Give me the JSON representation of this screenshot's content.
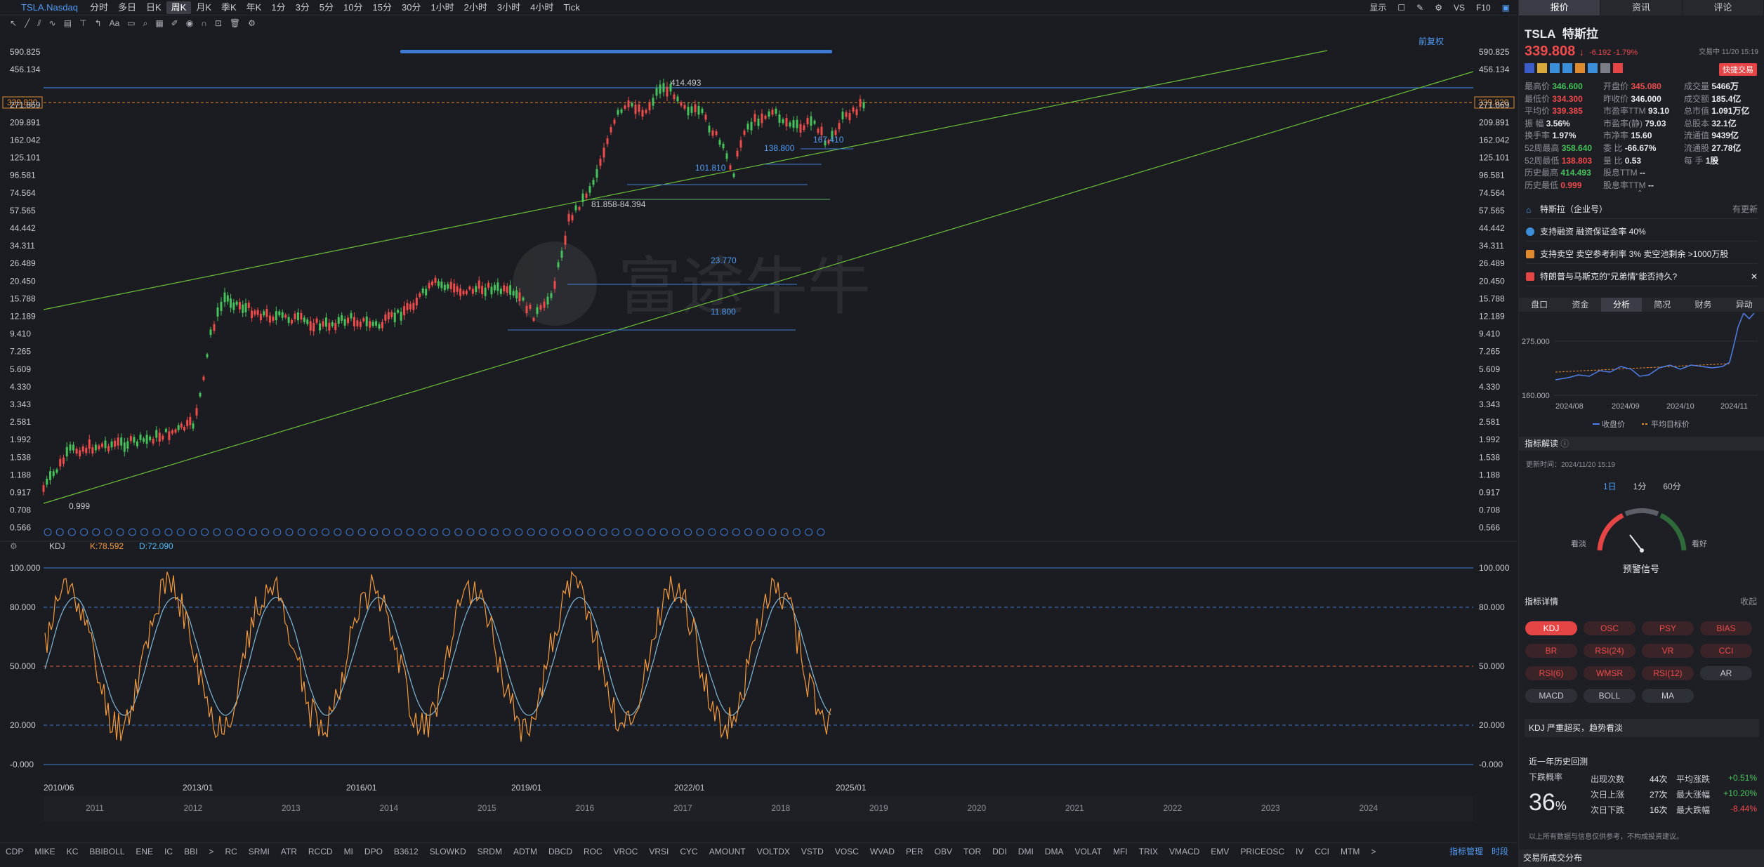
{
  "app": {
    "symbol": "TSLA.Nasdaq"
  },
  "timeframes": [
    "分时",
    "多日",
    "日K",
    "周K",
    "月K",
    "季K",
    "年K",
    "1分",
    "3分",
    "5分",
    "10分",
    "15分",
    "30分",
    "1小时",
    "2小时",
    "3小时",
    "4小时",
    "Tick"
  ],
  "active_timeframe": "周K",
  "topbar_right": {
    "display": "显示",
    "vs": "VS",
    "f10": "F10"
  },
  "chart_header": {
    "adjust": "前复权"
  },
  "price_axis": [
    "590.825",
    "456.134",
    "339.820",
    "271.869",
    "209.891",
    "162.042",
    "125.101",
    "96.581",
    "74.564",
    "57.565",
    "44.442",
    "34.311",
    "26.489",
    "20.450",
    "15.788",
    "12.189",
    "9.410",
    "7.265",
    "5.609",
    "4.330",
    "3.343",
    "2.581",
    "1.992",
    "1.538",
    "1.188",
    "0.917",
    "0.708",
    "0.566"
  ],
  "current_price_tag": "339.820",
  "annotations": {
    "high": "414.493",
    "low_label": "0.999",
    "a1": "101.810",
    "a2": "81.858-84.394",
    "a3": "138.800",
    "a4": "167.410",
    "a5": "23.770",
    "a6": "11.800"
  },
  "kdj": {
    "name": "KDJ",
    "k": "K:78.592",
    "d": "D:72.090",
    "axis": [
      "100.000",
      "80.000",
      "50.000",
      "20.000",
      "-0.000"
    ]
  },
  "date_labels": [
    "2010/06",
    "2013/01",
    "2016/01",
    "2019/01",
    "2022/01",
    "2025/01"
  ],
  "overview_years": [
    "2011",
    "2012",
    "2013",
    "2014",
    "2015",
    "2016",
    "2017",
    "2018",
    "2019",
    "2020",
    "2021",
    "2022",
    "2023",
    "2024"
  ],
  "indicators": [
    "CDP",
    "MIKE",
    "KC",
    "BBIBOLL",
    "ENE",
    "IC",
    "BBI",
    ">",
    "RC",
    "SRMI",
    "ATR",
    "RCCD",
    "MI",
    "DPO",
    "B3612",
    "SLOWKD",
    "SRDM",
    "ADTM",
    "DBCD",
    "ROC",
    "VROC",
    "VRSI",
    "CYC",
    "AMOUNT",
    "VOLTDX",
    "VSTD",
    "VOSC",
    "WVAD",
    "PER",
    "OBV",
    "TOR",
    "DDI",
    "DMI",
    "DMA",
    "VOLAT",
    "MFI",
    "TRIX",
    "VMACD",
    "EMV",
    "PRICEOSC",
    "IV",
    "CCI",
    "MTM",
    ">"
  ],
  "indicator_mgmt": "指标管理",
  "period_label": "时段",
  "panel": {
    "tabs": [
      "报价",
      "资讯",
      "评论"
    ],
    "ticker": "TSLA",
    "name": "特斯拉",
    "trade_time": "交易中 11/20 15:19",
    "price": "339.808",
    "change": "-6.192",
    "change_pct": "-1.79%",
    "quick_trade": "快捷交易",
    "col1": [
      [
        "最高价",
        "346.600"
      ],
      [
        "最低价",
        "334.300"
      ],
      [
        "平均价",
        "339.385"
      ],
      [
        "振  幅",
        "3.56%"
      ],
      [
        "换手率",
        "1.97%"
      ],
      [
        "52周最高",
        "358.640"
      ],
      [
        "52周最低",
        "138.803"
      ],
      [
        "历史最高",
        "414.493"
      ],
      [
        "历史最低",
        "0.999"
      ]
    ],
    "col2": [
      [
        "开盘价",
        "345.080"
      ],
      [
        "昨收价",
        "346.000"
      ],
      [
        "市盈率TTM",
        "93.10"
      ],
      [
        "市盈率(静)",
        "79.03"
      ],
      [
        "市净率",
        "15.60"
      ],
      [
        "委  比",
        "-66.67%"
      ],
      [
        "量  比",
        "0.53"
      ],
      [
        "股息TTM",
        "--"
      ],
      [
        "股息率TTM",
        "--"
      ]
    ],
    "col3": [
      [
        "成交量",
        "5466万"
      ],
      [
        "成交额",
        "185.4亿"
      ],
      [
        "总市值",
        "1.091万亿"
      ],
      [
        "总股本",
        "32.1亿"
      ],
      [
        "流通值",
        "9439亿"
      ],
      [
        "流通股",
        "27.78亿"
      ],
      [
        "每  手",
        "1股"
      ]
    ],
    "news": [
      {
        "text": "特斯拉（企业号）",
        "extra": "有更新"
      },
      {
        "text": "支持融资   融资保证金率 40%",
        "extra": ""
      },
      {
        "text": "支持卖空   卖空参考利率 3%   卖空池剩余 >1000万股",
        "extra": ""
      },
      {
        "text": "特朗普与马斯克的\"兄弟情\"能否持久?",
        "extra": ""
      }
    ],
    "subtabs": [
      "盘口",
      "资金",
      "分析",
      "简况",
      "财务",
      "异动"
    ],
    "active_subtab": "分析",
    "mini_chart": {
      "y_labels": [
        "275.000",
        "160.000"
      ],
      "x_labels": [
        "2024/08",
        "2024/09",
        "2024/10",
        "2024/11"
      ],
      "legend": [
        "收盘价",
        "平均目标价"
      ]
    },
    "indicator_section": "指标解读",
    "update_time": "更新时间：2024/11/20 15:19",
    "periods": [
      "1日",
      "1分",
      "60分"
    ],
    "gauge": {
      "left": "看淡",
      "right": "看好",
      "title": "预警信号"
    },
    "detail_title": "指标详情",
    "collapse": "收起",
    "pills": [
      "KDJ",
      "OSC",
      "PSY",
      "BIAS",
      "BR",
      "RSI(24)",
      "VR",
      "CCI",
      "RSI(6)",
      "WMSR",
      "RSI(12)",
      "AR",
      "MACD",
      "BOLL",
      "MA"
    ],
    "signal": "KDJ 严重超买，趋势看淡",
    "history_title": "近一年历史回测",
    "fall_prob_label": "下跌概率",
    "fall_prob": "36",
    "stats": [
      [
        "出现次数",
        "44次",
        "平均涨跌",
        "+0.51%"
      ],
      [
        "次日上涨",
        "27次",
        "最大涨幅",
        "+10.20%"
      ],
      [
        "次日下跌",
        "16次",
        "最大跌幅",
        "-8.44%"
      ]
    ],
    "disclaimer": "以上所有数据与信息仅供参考，不构成投资建议。",
    "bottom_section": "交易所成交分布"
  },
  "chart_data": {
    "type": "line",
    "title": "",
    "series": [
      {
        "name": "",
        "values": []
      }
    ]
  }
}
